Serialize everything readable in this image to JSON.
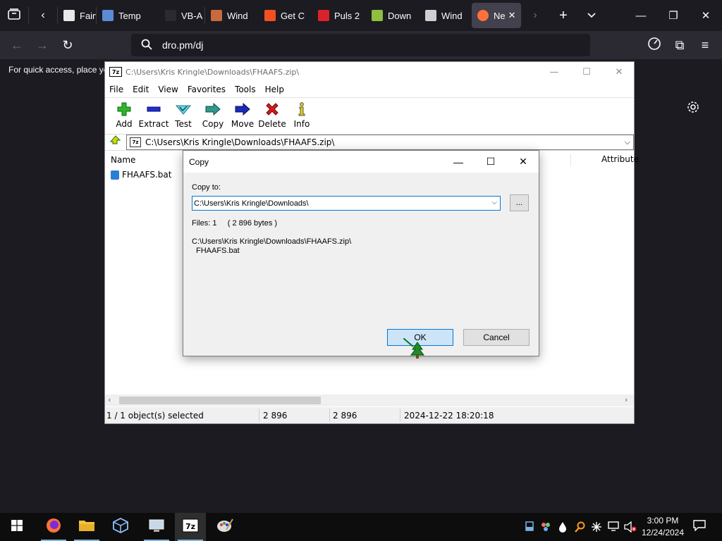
{
  "browser": {
    "tabs": [
      {
        "label": "Fairw",
        "color": "#e8e8e8"
      },
      {
        "label": "Temp",
        "color": "#5b8bd6"
      },
      {
        "label": "VB-A",
        "color": "#2b2a33"
      },
      {
        "label": "Wind",
        "color": "#c86a3c"
      },
      {
        "label": "Get C",
        "color": "#f25022"
      },
      {
        "label": "Puls 2",
        "color": "#d8232a"
      },
      {
        "label": "Down",
        "color": "#8fbf3f"
      },
      {
        "label": "Wind",
        "color": "#cfcfcf"
      },
      {
        "label": "Ne",
        "color": "#ff7139"
      }
    ],
    "url": "dro.pm/dj",
    "quick_access_text": "For quick access, place yo"
  },
  "sevenzip": {
    "title": "C:\\Users\\Kris Kringle\\Downloads\\FHAAFS.zip\\",
    "logo_text": "7z",
    "menu": [
      "File",
      "Edit",
      "View",
      "Favorites",
      "Tools",
      "Help"
    ],
    "toolbar": {
      "add": "Add",
      "extract": "Extract",
      "test": "Test",
      "copy": "Copy",
      "move": "Move",
      "delete": "Delete",
      "info": "Info"
    },
    "address": "C:\\Users\\Kris Kringle\\Downloads\\FHAAFS.zip\\",
    "columns": {
      "name": "Name",
      "attributes": "Attribute"
    },
    "files": [
      {
        "name": "FHAAFS.bat"
      }
    ],
    "status": {
      "selected": "1 / 1 object(s) selected",
      "size": "2 896",
      "packed": "2 896",
      "modified": "2024-12-22 18:20:18"
    }
  },
  "copy_dialog": {
    "title": "Copy",
    "copy_to_label": "Copy to:",
    "destination": "C:\\Users\\Kris Kringle\\Downloads\\",
    "browse_label": "...",
    "files_info": "Files: 1     ( 2 896 bytes )",
    "source_path": "C:\\Users\\Kris Kringle\\Downloads\\FHAAFS.zip\\",
    "source_file": "FHAAFS.bat",
    "ok_label": "OK",
    "cancel_label": "Cancel"
  },
  "taskbar": {
    "time": "3:00 PM",
    "date": "12/24/2024",
    "apps": [
      "windows-start",
      "firefox",
      "file-explorer",
      "virtualbox",
      "remote-desktop",
      "7zip",
      "paint"
    ]
  }
}
